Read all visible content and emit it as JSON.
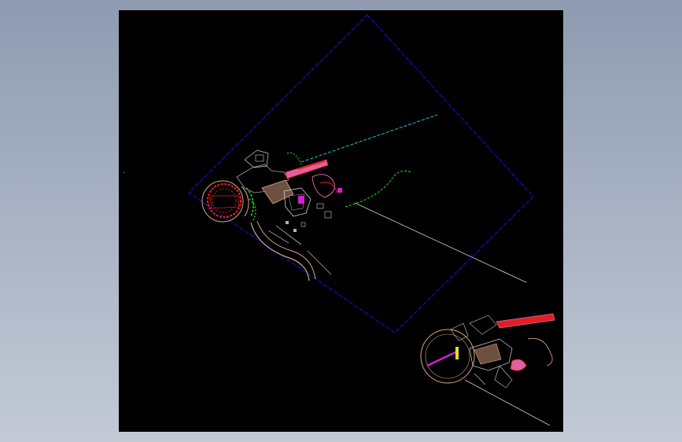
{
  "viewport": {
    "background": "#000000",
    "frame_gradient": [
      "#8e9bb0",
      "#c3cad6"
    ]
  },
  "drawing": {
    "colors": {
      "boundary": "#1010c8",
      "cyan": "#19c8d8",
      "white": "#d0d0d0",
      "red": "#e02020",
      "green": "#20e020",
      "tan": "#d8a880",
      "pink": "#e060a0",
      "magenta": "#d020d0",
      "yellow": "#e0e020",
      "gray": "#a0a0a0"
    },
    "icons": [
      "cad-site-plan",
      "cad-detail-plan"
    ]
  }
}
